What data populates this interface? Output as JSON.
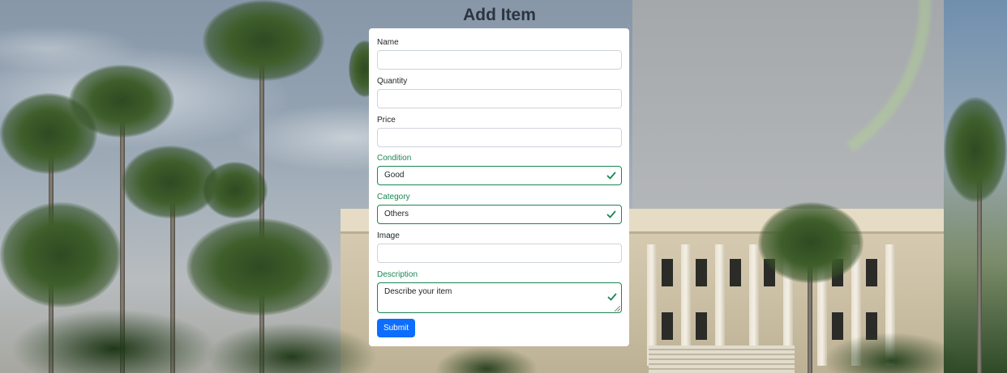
{
  "title": "Add Item",
  "form": {
    "fields": [
      {
        "label": "Name",
        "value": "",
        "valid": false
      },
      {
        "label": "Quantity",
        "value": "",
        "valid": false
      },
      {
        "label": "Price",
        "value": "",
        "valid": false
      },
      {
        "label": "Condition",
        "value": "Good",
        "valid": true
      },
      {
        "label": "Category",
        "value": "Others",
        "valid": true
      },
      {
        "label": "Image",
        "value": "",
        "valid": false
      },
      {
        "label": "Description",
        "placeholder": "Describe your item",
        "valid": true
      }
    ],
    "submit_label": "Submit"
  },
  "colors": {
    "valid": "#198754",
    "primary": "#0d6efd",
    "title": "#2c3440"
  },
  "icons": {
    "valid_indicator": "check-icon"
  }
}
